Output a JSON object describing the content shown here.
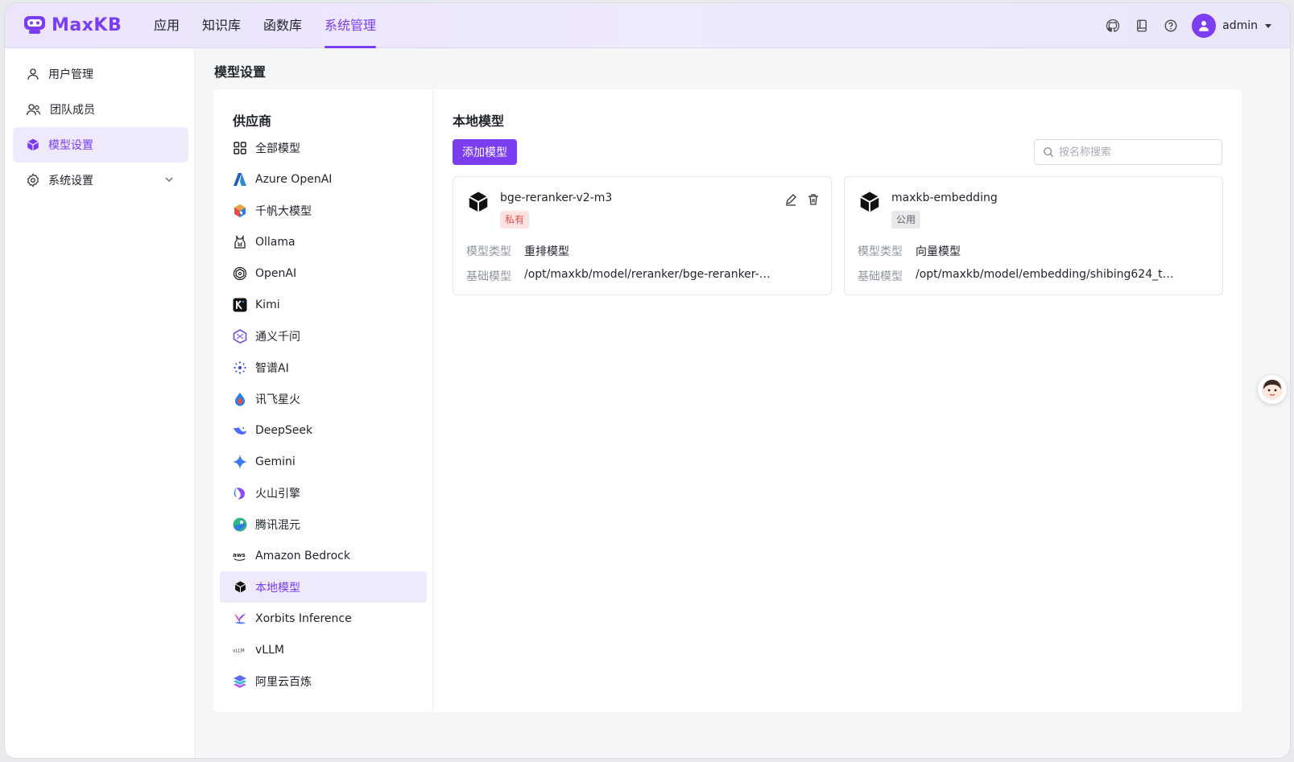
{
  "app": {
    "name": "MaxKB"
  },
  "nav": [
    {
      "label": "应用",
      "active": false
    },
    {
      "label": "知识库",
      "active": false
    },
    {
      "label": "函数库",
      "active": false
    },
    {
      "label": "系统管理",
      "active": true
    }
  ],
  "user": {
    "name": "admin"
  },
  "sidebar": {
    "items": [
      {
        "label": "用户管理",
        "icon": "user-icon"
      },
      {
        "label": "团队成员",
        "icon": "team-icon"
      },
      {
        "label": "模型设置",
        "icon": "cube-icon",
        "active": true
      },
      {
        "label": "系统设置",
        "icon": "gear-icon",
        "expandable": true
      }
    ]
  },
  "page": {
    "title": "模型设置"
  },
  "providers": {
    "title": "供应商",
    "items": [
      {
        "label": "全部模型",
        "icon": "grid-icon"
      },
      {
        "label": "Azure OpenAI",
        "icon": "azure-icon"
      },
      {
        "label": "千帆大模型",
        "icon": "qianfan-icon"
      },
      {
        "label": "Ollama",
        "icon": "ollama-icon"
      },
      {
        "label": "OpenAI",
        "icon": "openai-icon"
      },
      {
        "label": "Kimi",
        "icon": "kimi-icon"
      },
      {
        "label": "通义千问",
        "icon": "tongyi-icon"
      },
      {
        "label": "智谱AI",
        "icon": "zhipu-icon"
      },
      {
        "label": "讯飞星火",
        "icon": "xunfei-icon"
      },
      {
        "label": "DeepSeek",
        "icon": "deepseek-icon"
      },
      {
        "label": "Gemini",
        "icon": "gemini-icon"
      },
      {
        "label": "火山引擎",
        "icon": "volcano-icon"
      },
      {
        "label": "腾讯混元",
        "icon": "hunyuan-icon"
      },
      {
        "label": "Amazon Bedrock",
        "icon": "aws-icon"
      },
      {
        "label": "本地模型",
        "icon": "local-cube-icon",
        "active": true
      },
      {
        "label": "Xorbits Inference",
        "icon": "xorbits-icon"
      },
      {
        "label": "vLLM",
        "icon": "vllm-icon"
      },
      {
        "label": "阿里云百炼",
        "icon": "bailian-icon"
      }
    ]
  },
  "content": {
    "title": "本地模型",
    "add_button": "添加模型",
    "search_placeholder": "按名称搜索",
    "type_label": "模型类型",
    "base_label": "基础模型",
    "models": [
      {
        "name": "bge-reranker-v2-m3",
        "tag": "私有",
        "type": "重排模型",
        "base": "/opt/maxkb/model/reranker/bge-reranker-…"
      },
      {
        "name": "maxkb-embedding",
        "tag": "公用",
        "type": "向量模型",
        "base": "/opt/maxkb/model/embedding/shibing624_t…"
      }
    ]
  },
  "colors": {
    "accent": "#7a3df0",
    "private_tag": "#e04e4e",
    "public_tag": "#606266"
  }
}
